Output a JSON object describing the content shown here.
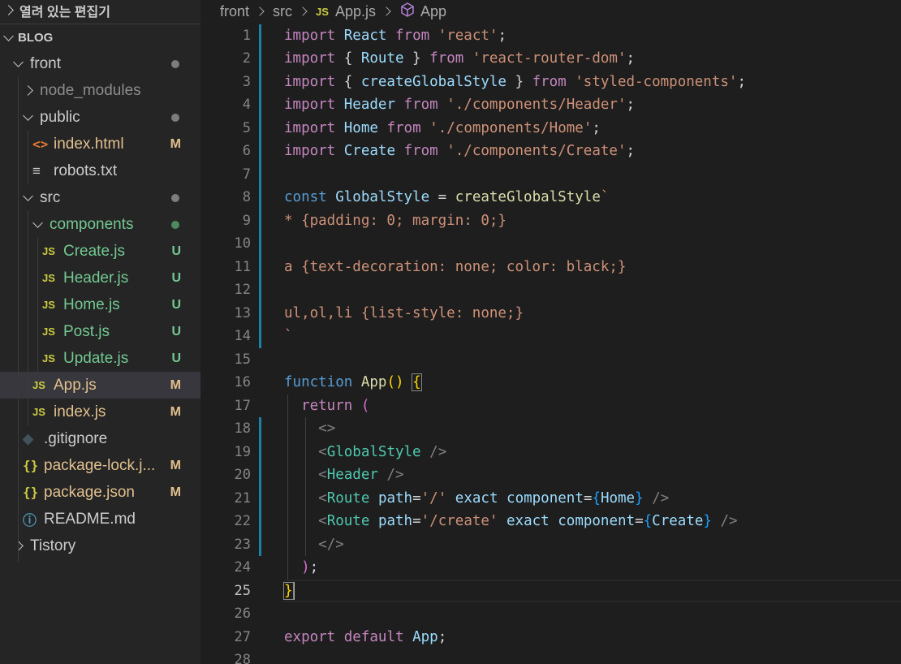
{
  "sidebar": {
    "open_editors": "열려 있는 편집기",
    "workspace": "BLOG",
    "items": [
      {
        "label": "front",
        "kind": "folder-open",
        "status": "dot"
      },
      {
        "label": "node_modules",
        "kind": "folder-closed",
        "status": ""
      },
      {
        "label": "public",
        "kind": "folder-open",
        "status": "dot"
      },
      {
        "label": "index.html",
        "kind": "html",
        "status": "M"
      },
      {
        "label": "robots.txt",
        "kind": "txt",
        "status": ""
      },
      {
        "label": "src",
        "kind": "folder-open",
        "status": "dot"
      },
      {
        "label": "components",
        "kind": "folder-open",
        "status": "dot-green"
      },
      {
        "label": "Create.js",
        "kind": "js",
        "status": "U"
      },
      {
        "label": "Header.js",
        "kind": "js",
        "status": "U"
      },
      {
        "label": "Home.js",
        "kind": "js",
        "status": "U"
      },
      {
        "label": "Post.js",
        "kind": "js",
        "status": "U"
      },
      {
        "label": "Update.js",
        "kind": "js",
        "status": "U"
      },
      {
        "label": "App.js",
        "kind": "js",
        "status": "M"
      },
      {
        "label": "index.js",
        "kind": "js",
        "status": "M"
      },
      {
        "label": ".gitignore",
        "kind": "git",
        "status": ""
      },
      {
        "label": "package-lock.j...",
        "kind": "json",
        "status": "M"
      },
      {
        "label": "package.json",
        "kind": "json",
        "status": "M"
      },
      {
        "label": "README.md",
        "kind": "info",
        "status": ""
      },
      {
        "label": "Tistory",
        "kind": "folder-closed",
        "status": ""
      }
    ],
    "icons": {
      "js": "JS",
      "html": "<>",
      "json": "{}",
      "txt": "≡",
      "git": "◆",
      "info": "ⓘ"
    }
  },
  "breadcrumb": {
    "parts": [
      "front",
      "src",
      "App.js",
      "App"
    ],
    "js_icon": "JS",
    "symbol_icon": "⬡"
  },
  "editor": {
    "line_numbers": [
      "1",
      "2",
      "3",
      "4",
      "5",
      "6",
      "7",
      "8",
      "9",
      "10",
      "11",
      "12",
      "13",
      "14",
      "15",
      "16",
      "17",
      "18",
      "19",
      "20",
      "21",
      "22",
      "23",
      "24",
      "25",
      "26",
      "27",
      "28"
    ],
    "current_line": "25",
    "code": [
      [
        [
          "k",
          "import"
        ],
        [
          "p",
          " "
        ],
        [
          "v",
          "React"
        ],
        [
          "p",
          " "
        ],
        [
          "k",
          "from"
        ],
        [
          "p",
          " "
        ],
        [
          "s",
          "'react'"
        ],
        [
          "p",
          ";"
        ]
      ],
      [
        [
          "k",
          "import"
        ],
        [
          "p",
          " { "
        ],
        [
          "v",
          "Route"
        ],
        [
          "p",
          " } "
        ],
        [
          "k",
          "from"
        ],
        [
          "p",
          " "
        ],
        [
          "s",
          "'react-router-dom'"
        ],
        [
          "p",
          ";"
        ]
      ],
      [
        [
          "k",
          "import"
        ],
        [
          "p",
          " { "
        ],
        [
          "v",
          "createGlobalStyle"
        ],
        [
          "p",
          " } "
        ],
        [
          "k",
          "from"
        ],
        [
          "p",
          " "
        ],
        [
          "s",
          "'styled-components'"
        ],
        [
          "p",
          ";"
        ]
      ],
      [
        [
          "k",
          "import"
        ],
        [
          "p",
          " "
        ],
        [
          "v",
          "Header"
        ],
        [
          "p",
          " "
        ],
        [
          "k",
          "from"
        ],
        [
          "p",
          " "
        ],
        [
          "s",
          "'./components/Header'"
        ],
        [
          "p",
          ";"
        ]
      ],
      [
        [
          "k",
          "import"
        ],
        [
          "p",
          " "
        ],
        [
          "v",
          "Home"
        ],
        [
          "p",
          " "
        ],
        [
          "k",
          "from"
        ],
        [
          "p",
          " "
        ],
        [
          "s",
          "'./components/Home'"
        ],
        [
          "p",
          ";"
        ]
      ],
      [
        [
          "k",
          "import"
        ],
        [
          "p",
          " "
        ],
        [
          "v",
          "Create"
        ],
        [
          "p",
          " "
        ],
        [
          "k",
          "from"
        ],
        [
          "p",
          " "
        ],
        [
          "s",
          "'./components/Create'"
        ],
        [
          "p",
          ";"
        ]
      ],
      [],
      [
        [
          "st",
          "const"
        ],
        [
          "p",
          " "
        ],
        [
          "v",
          "GlobalStyle"
        ],
        [
          "p",
          " = "
        ],
        [
          "f",
          "createGlobalStyle"
        ],
        [
          "s",
          "`"
        ]
      ],
      [
        [
          "s",
          "* {padding: 0; margin: 0;}"
        ]
      ],
      [],
      [
        [
          "s",
          "a {text-decoration: none; color: black;}"
        ]
      ],
      [],
      [
        [
          "s",
          "ul,ol,li {list-style: none;}"
        ]
      ],
      [
        [
          "s",
          "`"
        ]
      ],
      [],
      [
        [
          "st",
          "function"
        ],
        [
          "p",
          " "
        ],
        [
          "f",
          "App"
        ],
        [
          "y",
          "()"
        ],
        [
          "p",
          " "
        ],
        [
          "y",
          "{"
        ]
      ],
      [
        [
          "p",
          "  "
        ],
        [
          "k",
          "return"
        ],
        [
          "p",
          " "
        ],
        [
          "pk",
          "("
        ]
      ],
      [
        [
          "p",
          "    "
        ],
        [
          "g",
          "<>"
        ]
      ],
      [
        [
          "p",
          "    "
        ],
        [
          "g",
          "<"
        ],
        [
          "t",
          "GlobalStyle"
        ],
        [
          "p",
          " "
        ],
        [
          "g",
          "/>"
        ]
      ],
      [
        [
          "p",
          "    "
        ],
        [
          "g",
          "<"
        ],
        [
          "t",
          "Header"
        ],
        [
          "p",
          " "
        ],
        [
          "g",
          "/>"
        ]
      ],
      [
        [
          "p",
          "    "
        ],
        [
          "g",
          "<"
        ],
        [
          "t",
          "Route"
        ],
        [
          "p",
          " "
        ],
        [
          "v",
          "path"
        ],
        [
          "p",
          "="
        ],
        [
          "s",
          "'/'"
        ],
        [
          "p",
          " "
        ],
        [
          "v",
          "exact"
        ],
        [
          "p",
          " "
        ],
        [
          "v",
          "component"
        ],
        [
          "p",
          "="
        ],
        [
          "bl",
          "{"
        ],
        [
          "v",
          "Home"
        ],
        [
          "bl",
          "}"
        ],
        [
          "p",
          " "
        ],
        [
          "g",
          "/>"
        ]
      ],
      [
        [
          "p",
          "    "
        ],
        [
          "g",
          "<"
        ],
        [
          "t",
          "Route"
        ],
        [
          "p",
          " "
        ],
        [
          "v",
          "path"
        ],
        [
          "p",
          "="
        ],
        [
          "s",
          "'/create'"
        ],
        [
          "p",
          " "
        ],
        [
          "v",
          "exact"
        ],
        [
          "p",
          " "
        ],
        [
          "v",
          "component"
        ],
        [
          "p",
          "="
        ],
        [
          "bl",
          "{"
        ],
        [
          "v",
          "Create"
        ],
        [
          "bl",
          "}"
        ],
        [
          "p",
          " "
        ],
        [
          "g",
          "/>"
        ]
      ],
      [
        [
          "p",
          "    "
        ],
        [
          "g",
          "</>"
        ]
      ],
      [
        [
          "p",
          "  "
        ],
        [
          "pk",
          ")"
        ],
        [
          "p",
          ";"
        ]
      ],
      [
        [
          "y",
          "}"
        ]
      ],
      [],
      [
        [
          "k",
          "export"
        ],
        [
          "p",
          " "
        ],
        [
          "k",
          "default"
        ],
        [
          "p",
          " "
        ],
        [
          "v",
          "App"
        ],
        [
          "p",
          ";"
        ]
      ],
      []
    ]
  }
}
